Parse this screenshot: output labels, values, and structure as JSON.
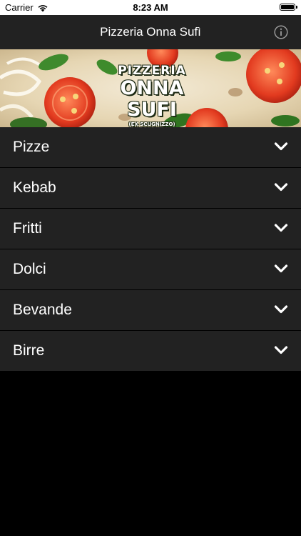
{
  "status_bar": {
    "carrier": "Carrier",
    "time": "8:23 AM",
    "wifi_icon": "wifi-icon",
    "battery_icon": "battery-icon",
    "battery_level": 1.0
  },
  "nav_bar": {
    "title": "Pizzeria Onna Sufì",
    "info_icon": "info-circle-icon"
  },
  "banner": {
    "logo_line1": "PIZZERIA",
    "logo_line2": "ONNA SUFI",
    "logo_line3": "(EX SCUGNIZZO)"
  },
  "menu": {
    "items": [
      {
        "label": "Pizze"
      },
      {
        "label": "Kebab"
      },
      {
        "label": "Fritti"
      },
      {
        "label": "Dolci"
      },
      {
        "label": "Bevande"
      },
      {
        "label": "Birre"
      }
    ],
    "chevron_icon": "chevron-down-icon"
  },
  "colors": {
    "nav_background": "#222222",
    "row_background": "#222222",
    "screen_background": "#000000",
    "text": "#ffffff"
  }
}
